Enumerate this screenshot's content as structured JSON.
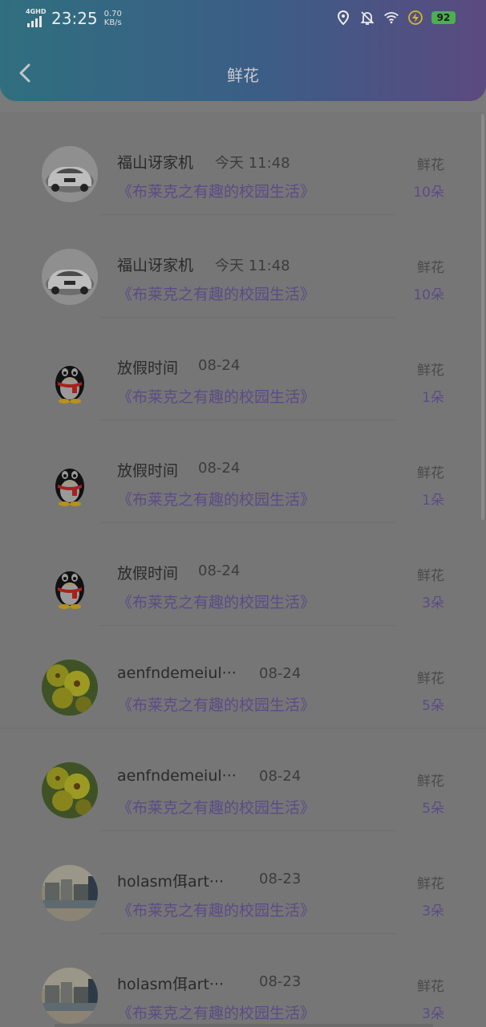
{
  "status_bar": {
    "network": "4GHD",
    "time": "23:25",
    "speed_value": "0.70",
    "speed_unit": "KB/s",
    "battery": "92"
  },
  "header": {
    "title": "鲜花",
    "back_icon": "chevron-left-icon"
  },
  "rows": [
    {
      "name": "福山讶家机",
      "time": "今天 11:48",
      "book": "《布莱克之有趣的校园生活》",
      "category": "鲜花",
      "count": "10朵",
      "avatar": "car"
    },
    {
      "name": "福山讶家机",
      "time": "今天 11:48",
      "book": "《布莱克之有趣的校园生活》",
      "category": "鲜花",
      "count": "10朵",
      "avatar": "car"
    },
    {
      "name": "放假时间",
      "time": "08-24",
      "book": "《布莱克之有趣的校园生活》",
      "category": "鲜花",
      "count": "1朵",
      "avatar": "penguin"
    },
    {
      "name": "放假时间",
      "time": "08-24",
      "book": "《布莱克之有趣的校园生活》",
      "category": "鲜花",
      "count": "1朵",
      "avatar": "penguin"
    },
    {
      "name": "放假时间",
      "time": "08-24",
      "book": "《布莱克之有趣的校园生活》",
      "category": "鲜花",
      "count": "3朵",
      "avatar": "penguin"
    },
    {
      "name": "aenfndemeiul···",
      "time": "08-24",
      "book": "《布莱克之有趣的校园生活》",
      "category": "鲜花",
      "count": "5朵",
      "avatar": "flower"
    },
    {
      "name": "aenfndemeiul···",
      "time": "08-24",
      "book": "《布莱克之有趣的校园生活》",
      "category": "鲜花",
      "count": "5朵",
      "avatar": "flower"
    },
    {
      "name": "holasm佴art···",
      "time": "08-23",
      "book": "《布莱克之有趣的校园生活》",
      "category": "鲜花",
      "count": "3朵",
      "avatar": "town"
    },
    {
      "name": "holasm佴art···",
      "time": "08-23",
      "book": "《布莱克之有趣的校园生活》",
      "category": "鲜花",
      "count": "3朵",
      "avatar": "town"
    }
  ]
}
